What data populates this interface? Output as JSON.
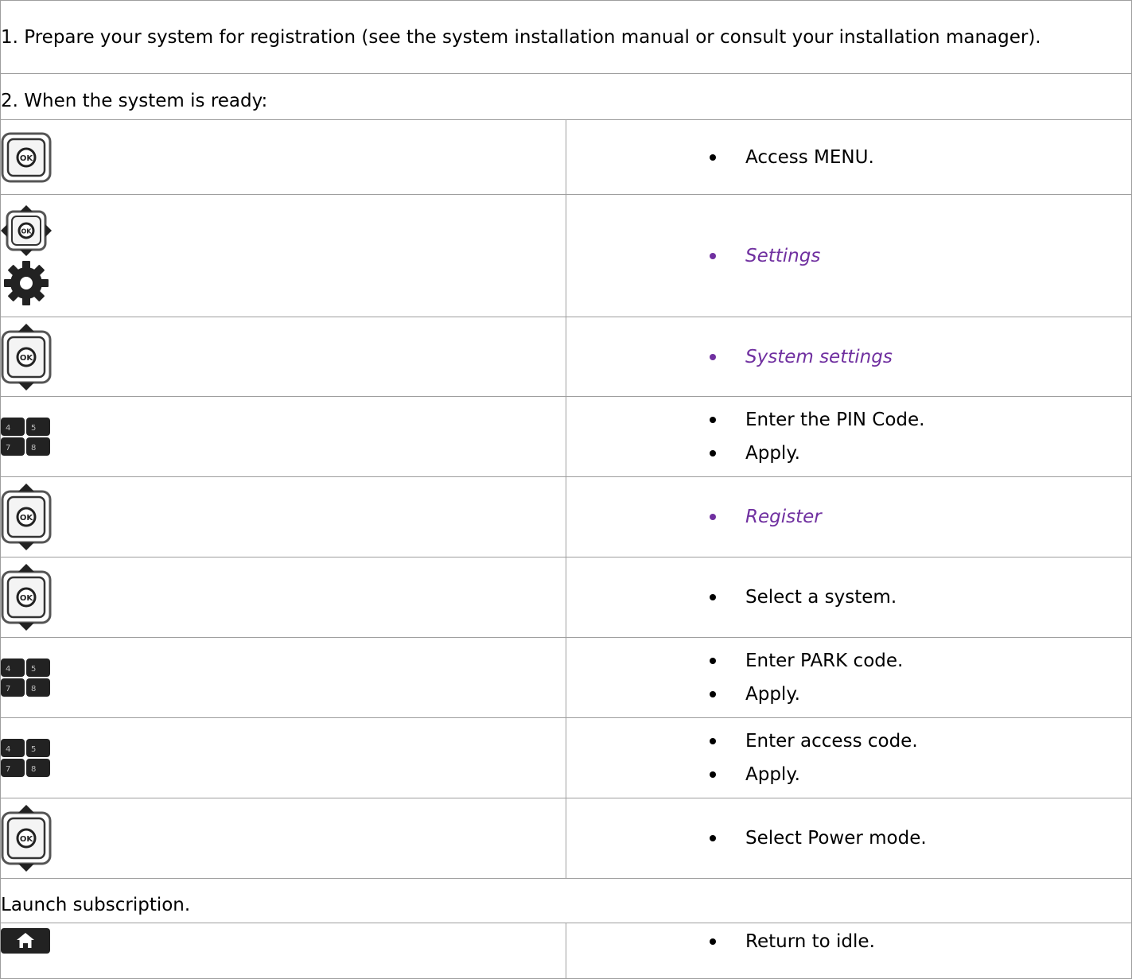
{
  "steps": {
    "intro": "1. Prepare your system for registration (see the system installation manual or consult your installation manager).",
    "when_ready": "2. When the system is ready:",
    "access_menu": "Access MENU.",
    "settings": "Settings",
    "system_settings": "System settings",
    "enter_pin": "Enter the PIN Code.",
    "apply": "Apply.",
    "register": "Register",
    "select_system": "Select a system.",
    "enter_park": "Enter PARK code.",
    "enter_access": "Enter access code.",
    "select_power": "Select Power mode.",
    "launch": "Launch subscription.",
    "return_idle": "Return to idle."
  },
  "keypad": {
    "k1": "4",
    "k2": "5",
    "k3": "7",
    "k4": "8"
  },
  "icons": {
    "ok_key": "ok-key-icon",
    "nav_4way": "navigation-4way-icon",
    "gear": "gear-icon",
    "nav_updown": "navigation-up-down-icon",
    "keypad": "keypad-icon",
    "home": "home-icon"
  },
  "colors": {
    "menu_path": "#7030a0",
    "border": "#9e9e9e"
  }
}
